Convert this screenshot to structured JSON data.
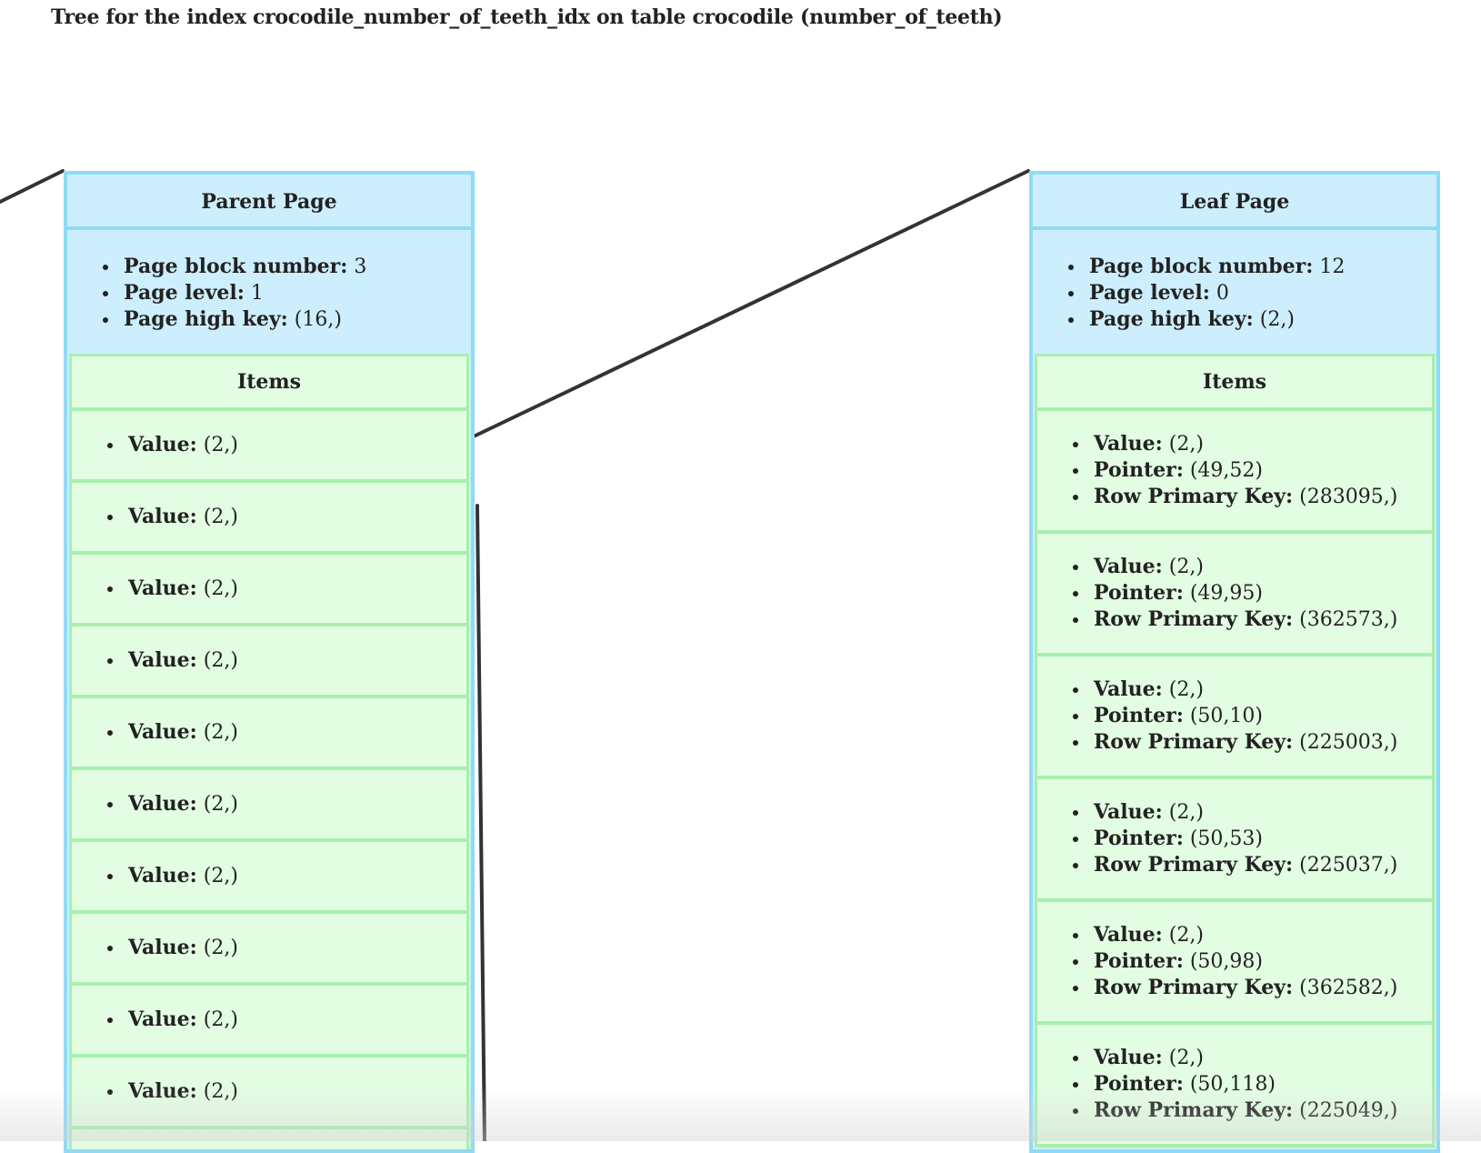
{
  "title": "Tree for the index crocodile_number_of_teeth_idx on table crocodile (number_of_teeth)",
  "parent_page": {
    "header": "Parent Page",
    "meta": [
      {
        "label": "Page block number:",
        "value": " 3"
      },
      {
        "label": "Page level:",
        "value": " 1"
      },
      {
        "label": "Page high key:",
        "value": " (16,)"
      }
    ],
    "items_header": "Items",
    "items": [
      {
        "label": "Value:",
        "value": " (2,)"
      },
      {
        "label": "Value:",
        "value": " (2,)"
      },
      {
        "label": "Value:",
        "value": " (2,)"
      },
      {
        "label": "Value:",
        "value": " (2,)"
      },
      {
        "label": "Value:",
        "value": " (2,)"
      },
      {
        "label": "Value:",
        "value": " (2,)"
      },
      {
        "label": "Value:",
        "value": " (2,)"
      },
      {
        "label": "Value:",
        "value": " (2,)"
      },
      {
        "label": "Value:",
        "value": " (2,)"
      },
      {
        "label": "Value:",
        "value": " (2,)"
      }
    ]
  },
  "leaf_page": {
    "header": "Leaf Page",
    "meta": [
      {
        "label": "Page block number:",
        "value": " 12"
      },
      {
        "label": "Page level:",
        "value": " 0"
      },
      {
        "label": "Page high key:",
        "value": " (2,)"
      }
    ],
    "items_header": "Items",
    "item_labels": {
      "value": "Value:",
      "pointer": "Pointer:",
      "row_pk": "Row Primary Key:"
    },
    "items": [
      {
        "value": " (2,)",
        "pointer": " (49,52)",
        "row_pk": " (283095,)"
      },
      {
        "value": " (2,)",
        "pointer": " (49,95)",
        "row_pk": " (362573,)"
      },
      {
        "value": " (2,)",
        "pointer": " (50,10)",
        "row_pk": " (225003,)"
      },
      {
        "value": " (2,)",
        "pointer": " (50,53)",
        "row_pk": " (225037,)"
      },
      {
        "value": " (2,)",
        "pointer": " (50,98)",
        "row_pk": " (362582,)"
      },
      {
        "value": " (2,)",
        "pointer": " (50,118)",
        "row_pk": " (225049,)"
      }
    ]
  }
}
